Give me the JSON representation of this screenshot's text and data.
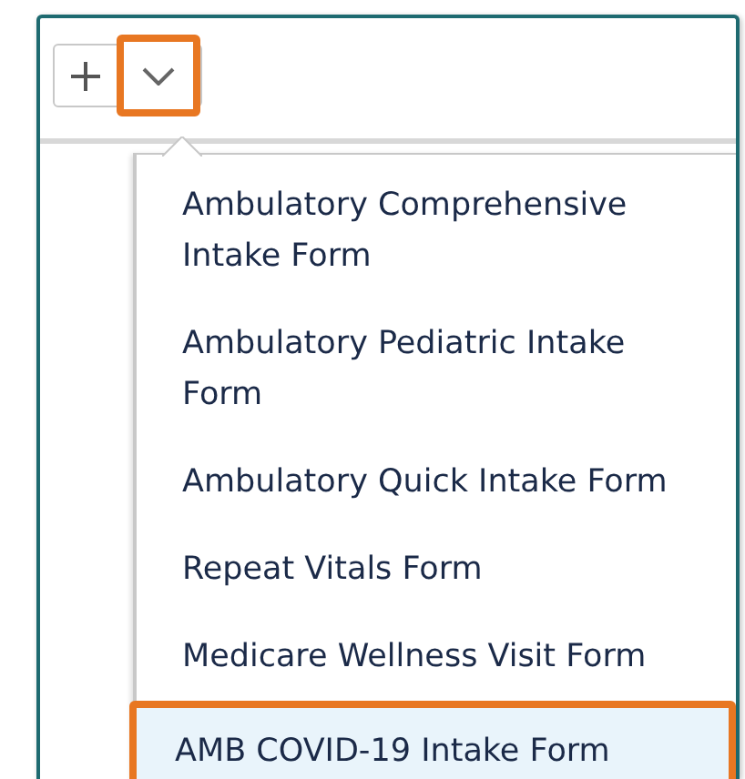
{
  "toolbar": {
    "buttons": [
      {
        "kind": "add",
        "highlighted": false
      },
      {
        "kind": "chevron",
        "highlighted": true
      }
    ]
  },
  "menu": {
    "items": [
      {
        "label": "Ambulatory Comprehensive Intake Form",
        "selected": false
      },
      {
        "label": "Ambulatory Pediatric Intake Form",
        "selected": false
      },
      {
        "label": "Ambulatory Quick Intake Form",
        "selected": false
      },
      {
        "label": "Repeat Vitals Form",
        "selected": false
      },
      {
        "label": "Medicare Wellness Visit Form",
        "selected": false
      },
      {
        "label": "AMB COVID-19 Intake Form",
        "selected": true
      }
    ]
  }
}
